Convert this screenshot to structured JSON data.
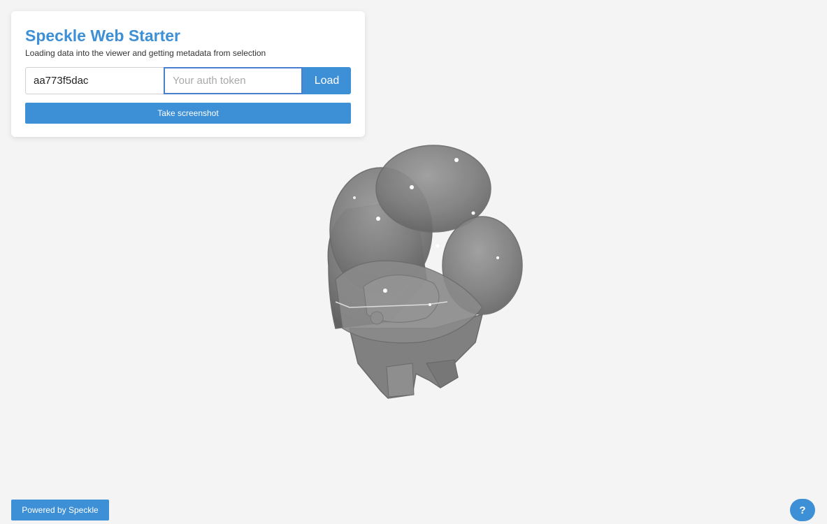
{
  "app": {
    "title": "Speckle Web Starter",
    "subtitle": "Loading data into the viewer and getting metadata from selection"
  },
  "form": {
    "stream_value": "aa773f5dac",
    "token_placeholder": "Your auth token",
    "token_value": "",
    "load_label": "Load",
    "screenshot_label": "Take screenshot"
  },
  "footer": {
    "powered_label": "Powered by Speckle",
    "help_label": "?"
  },
  "colors": {
    "accent": "#3d8fd6",
    "background": "#f4f4f4",
    "model": "#7d7d7d"
  }
}
